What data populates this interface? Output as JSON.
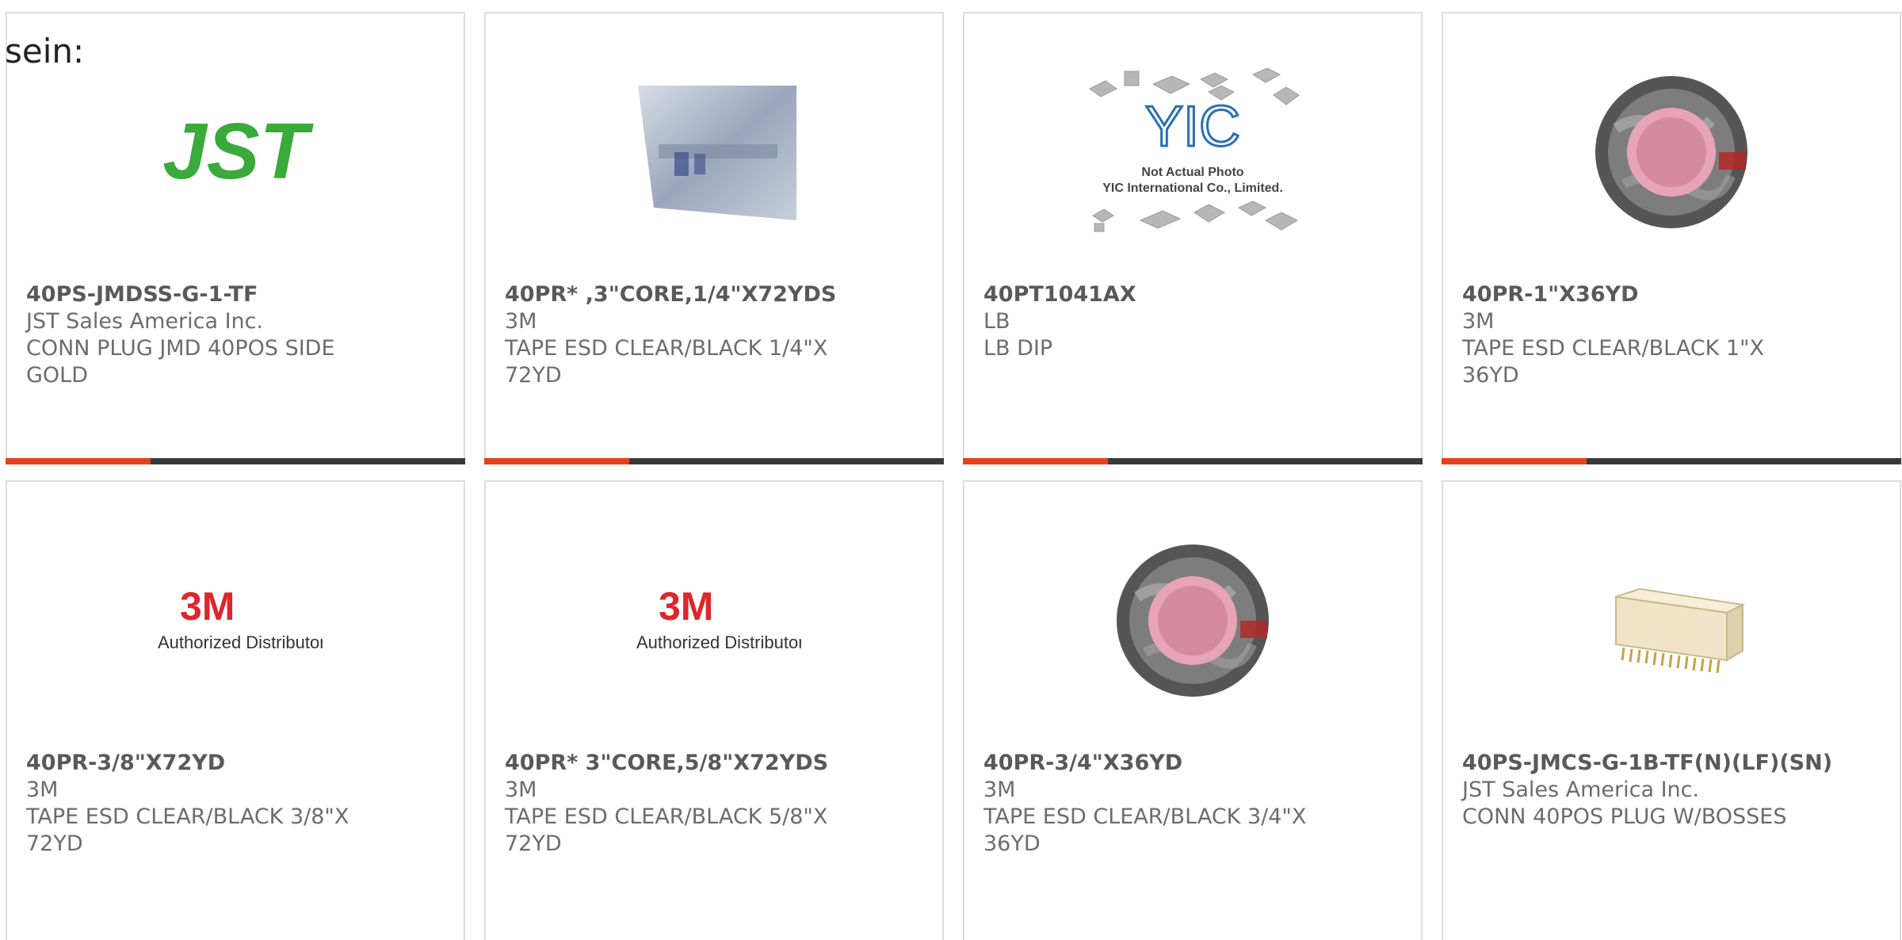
{
  "intro": "sein:",
  "colors": {
    "accent": "#e8401b",
    "bar": "#3a3a3a",
    "border": "#dddddd"
  },
  "products": [
    {
      "part": "40PS-JMDSS-G-1-TF",
      "maker": "JST Sales America Inc.",
      "desc": "CONN PLUG JMD 40POS SIDE\nGOLD",
      "image": "jst-logo",
      "logo_text": "JST"
    },
    {
      "part": "40PR* ,3\"CORE,1/4\"X72YDS",
      "maker": "3M",
      "desc": "TAPE ESD CLEAR/BLACK 1/4\"X\n72YD",
      "image": "esd-bag-photo"
    },
    {
      "part": "40PT1041AX",
      "maker": "LB",
      "desc": "LB DIP",
      "image": "yic-placeholder",
      "logo_text": "YIC",
      "photo_note": "Not Actual Photo",
      "photo_note2": "YIC International Co., Limited."
    },
    {
      "part": "40PR-1\"X36YD",
      "maker": "3M",
      "desc": "TAPE ESD CLEAR/BLACK 1\"X\n36YD",
      "image": "tape-roll-photo"
    },
    {
      "part": "40PR-3/8\"X72YD",
      "maker": "3M",
      "desc": "TAPE ESD CLEAR/BLACK 3/8\"X\n72YD",
      "image": "3m-logo",
      "logo_text": "3M",
      "logo_sub": "Authorized Distributor"
    },
    {
      "part": "40PR* 3\"CORE,5/8\"X72YDS",
      "maker": "3M",
      "desc": "TAPE ESD CLEAR/BLACK 5/8\"X\n72YD",
      "image": "3m-logo",
      "logo_text": "3M",
      "logo_sub": "Authorized Distributor"
    },
    {
      "part": "40PR-3/4\"X36YD",
      "maker": "3M",
      "desc": "TAPE ESD CLEAR/BLACK 3/4\"X\n36YD",
      "image": "tape-roll-photo"
    },
    {
      "part": "40PS-JMCS-G-1B-TF(N)(LF)(SN)",
      "maker": "JST Sales America Inc.",
      "desc": "CONN 40POS PLUG W/BOSSES",
      "image": "connector-photo"
    }
  ]
}
